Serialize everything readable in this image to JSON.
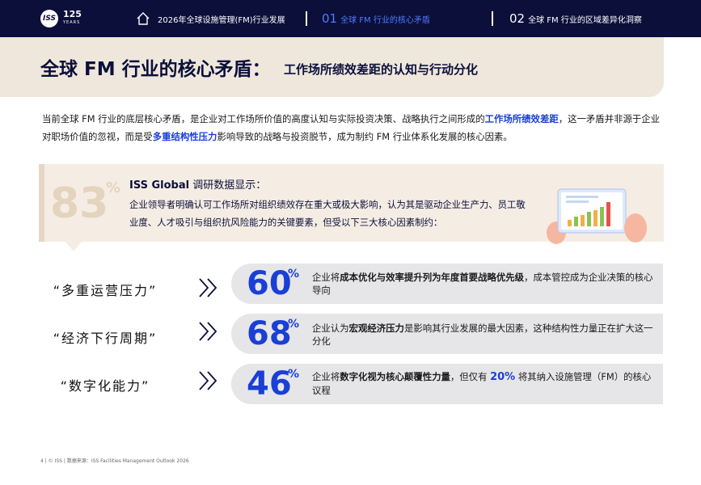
{
  "header": {
    "logo_mark": "ISS",
    "logo_number": "125",
    "logo_years": "YEARS",
    "nav_home_label": "2026年全球设施管理(FM)行业发展",
    "nav_items": [
      {
        "num": "01",
        "label": "全球 FM 行业的核心矛盾",
        "active": true
      },
      {
        "num": "02",
        "label": "全球 FM 行业的区域差异化洞察",
        "active": false
      }
    ],
    "active_color": "#4f7cff"
  },
  "title": {
    "main": "全球 FM 行业的核心矛盾：",
    "sub": "工作场所绩效差距的认知与行动分化"
  },
  "intro": {
    "part1": "当前全球 FM 行业的底层核心矛盾，是企业对工作场所价值的高度认知与实际投资决策、战略执行之间形成的",
    "highlight1": "工作场所绩效差距",
    "part2": "，这一矛盾并非源于企业对职场价值的忽视，而是受",
    "highlight2": "多重结构性压力",
    "part3": "影响导致的战略与投资脱节，成为制约 FM 行业体系化发展的核心因素。"
  },
  "stat": {
    "value": "83",
    "unit": "%",
    "source_bold": "ISS Global",
    "source_rest": " 调研数据显示：",
    "text": "企业领导者明确认可工作场所对组织绩效存在重大或极大影响，认为其是驱动企业生产力、员工敬业度、人才吸引与组织抗风险能力的关键要素，但受以下三大核心因素制约："
  },
  "rows": [
    {
      "label": "“多重运营压力”",
      "pct": "60",
      "pct_sign": "%",
      "pre": "企业将",
      "bold": "成本优化与效率提升列为年度首要战略优先级",
      "post": "，成本管控成为企业决策的核心导向"
    },
    {
      "label": "“经济下行周期”",
      "pct": "68",
      "pct_sign": "%",
      "pre": "企业认为",
      "bold": "宏观经济压力",
      "post": "是影响其行业发展的最大因素，这种结构性力量正在扩大这一分化"
    },
    {
      "label": "“数字化能力”",
      "pct": "46",
      "pct_sign": "%",
      "pre": "企业将",
      "bold": "数字化视为核心颠覆性力量",
      "mid": "，但仅有 ",
      "num": "20%",
      "post": " 将其纳入设施管理（FM）的核心议程"
    }
  ],
  "footer": {
    "page": "4",
    "copyright": "© ISS",
    "source": "数据来源：ISS Facilities Management Outlook 2026"
  },
  "colors": {
    "navy": "#0b0f3a",
    "accent_blue": "#1a3fd6",
    "beige": "#efe7dc",
    "pill_gray": "#e6e6e9"
  }
}
